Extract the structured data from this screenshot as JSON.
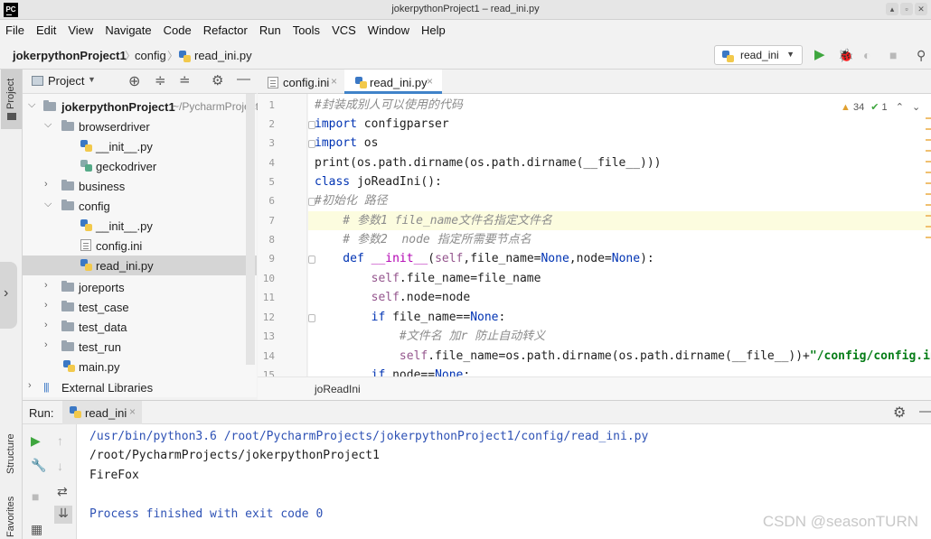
{
  "window": {
    "title": "jokerpythonProject1 – read_ini.py",
    "logo": "PC"
  },
  "menu": [
    "File",
    "Edit",
    "View",
    "Navigate",
    "Code",
    "Refactor",
    "Run",
    "Tools",
    "VCS",
    "Window",
    "Help"
  ],
  "breadcrumb": {
    "project": "jokerpythonProject1",
    "folder": "config",
    "file": "read_ini.py"
  },
  "run_config": {
    "label": "read_ini"
  },
  "left_stripe": {
    "project": "Project",
    "structure": "Structure",
    "favorites": "Favorites"
  },
  "project_panel": {
    "title": "Project",
    "root": {
      "name": "jokerpythonProject1",
      "path": "~/PycharmProject"
    },
    "items": [
      {
        "label": "browserdriver"
      },
      {
        "label": "__init__.py"
      },
      {
        "label": "geckodriver"
      },
      {
        "label": "business"
      },
      {
        "label": "config"
      },
      {
        "label": "__init__.py"
      },
      {
        "label": "config.ini"
      },
      {
        "label": "read_ini.py"
      },
      {
        "label": "joreports"
      },
      {
        "label": "test_case"
      },
      {
        "label": "test_data"
      },
      {
        "label": "test_run"
      },
      {
        "label": "main.py"
      },
      {
        "label": "External Libraries"
      }
    ]
  },
  "tabs": [
    {
      "label": "config.ini"
    },
    {
      "label": "read_ini.py"
    }
  ],
  "editor": {
    "line_numbers": [
      "1",
      "2",
      "3",
      "4",
      "5",
      "6",
      "7",
      "8",
      "9",
      "10",
      "11",
      "12",
      "13",
      "14",
      "15"
    ],
    "lines": {
      "l1": "#封装成别人可以使用的代码",
      "l2_kw": "import",
      "l2_rest": " configparser",
      "l3_kw": "import",
      "l3_rest": " os",
      "l4": "print(os.path.dirname(os.path.dirname(__file__)))",
      "l5_kw": "class",
      "l5_rest": " joReadIni():",
      "l6": "#初始化 路径",
      "l7": "    # 参数1 file_name文件名指定文件名",
      "l8": "    # 参数2  node 指定所需要节点名",
      "l9_kw": "    def",
      "l9_name": " __init__",
      "l9_p1": "(",
      "l9_self": "self",
      "l9_p2": ",file_name=",
      "l9_none1": "None",
      "l9_p3": ",node=",
      "l9_none2": "None",
      "l9_p4": "):",
      "l10_self": "        self",
      "l10_rest": ".file_name=file_name",
      "l11_self": "        self",
      "l11_rest": ".node=node",
      "l12_kw": "        if",
      "l12_rest": " file_name==",
      "l12_none": "None",
      "l12_end": ":",
      "l13": "            #文件名 加r 防止自动转义",
      "l14_self": "            self",
      "l14_rest": ".file_name=os.path.dirname(os.path.dirname(__file__))+",
      "l14_str": "\"/config/config.ini\"",
      "l15_kw": "        if",
      "l15_rest": " node==",
      "l15_none": "None",
      "l15_end": ":"
    },
    "inspections": {
      "warnings": "34",
      "ok": "1"
    },
    "breadcrumb": "joReadIni"
  },
  "run": {
    "label": "Run:",
    "tab": "read_ini",
    "output": [
      "/usr/bin/python3.6 /root/PycharmProjects/jokerpythonProject1/config/read_ini.py",
      "/root/PycharmProjects/jokerpythonProject1",
      "FireFox",
      "",
      "Process finished with exit code 0"
    ]
  },
  "watermark": "CSDN @seasonTURN",
  "colors": {
    "keyword": "#0033b3",
    "string": "#067d17",
    "comment": "#8c8c8c",
    "self": "#94558d",
    "accent": "#4083c9"
  }
}
